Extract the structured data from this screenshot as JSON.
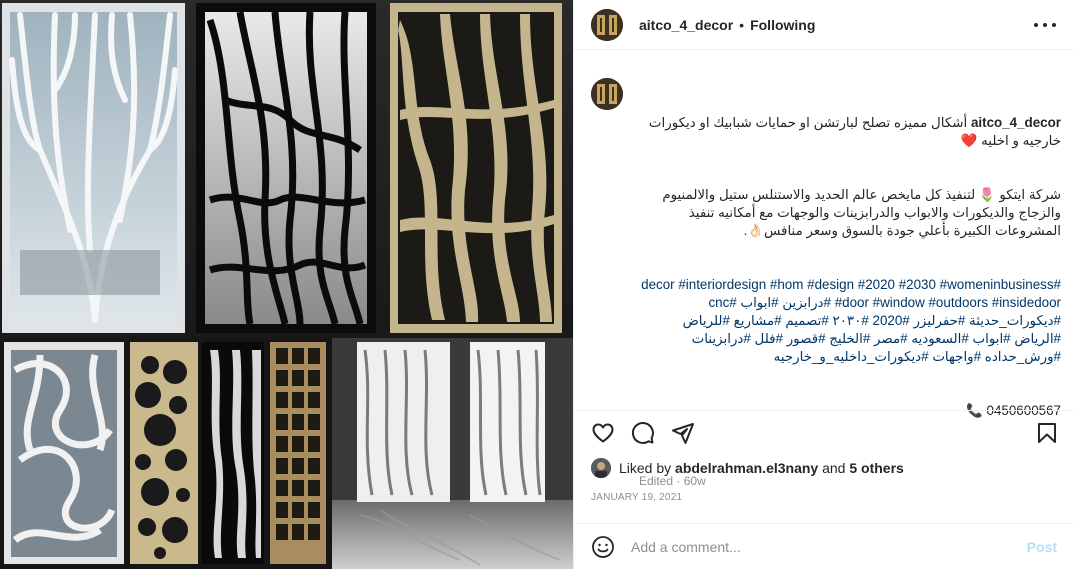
{
  "post": {
    "username": "aitco_4_decor",
    "separator": "•",
    "follow_status": "Following",
    "more_icon": "more-options-icon"
  },
  "caption": {
    "username": "aitco_4_decor",
    "line1": "أشكال مميزه تصلح لبارتشن او حمايات شبابيك او ديكورات خارجيه و اخليه ❤️",
    "line2": "شركة ايتكو 🌷 لتنفيذ كل مايخص عالم الحديد والاستنلس ستيل والالمنيوم والزجاج والديكورات والابواب والدرابزينات والوجهات مع أمكانيه تنفيذ المشروعات الكبيرة بأعلي جودة بالسوق وسعر منافس👌🏻.",
    "hashtags": "#decor #interiordesign #hom #design #2020 #2030 #womeninbusiness #door #window #outdoors #insidedoor #درابزين #ابواب #cnc #ديكورات_حديثة #حفرليزر #2020 #٢٠٣٠ #تصميم #مشاريع #للرياض #الرياض #ابواب #السعوديه #مصر #الخليج #قصور #فلل #درابزينات #ورش_حداده #واجهات #ديكورات_داخليه_و_خارجيه",
    "phone": "0450600567 📞",
    "edited": "Edited",
    "age": "60w"
  },
  "actions": {
    "like_icon": "heart-icon",
    "comment_icon": "comment-icon",
    "share_icon": "share-icon",
    "save_icon": "bookmark-icon"
  },
  "likes": {
    "prefix": "Liked by",
    "user": "abdelrahman.el3nany",
    "conj": "and",
    "others": "5 others"
  },
  "date": "JANUARY 19, 2021",
  "comment_box": {
    "emoji_icon": "emoji-icon",
    "placeholder": "Add a comment...",
    "post_label": "Post"
  },
  "colors": {
    "text": "#262626",
    "muted": "#8e8e8e",
    "link": "#00376b",
    "post_disabled": "#b2dffc",
    "border": "#efefef"
  }
}
